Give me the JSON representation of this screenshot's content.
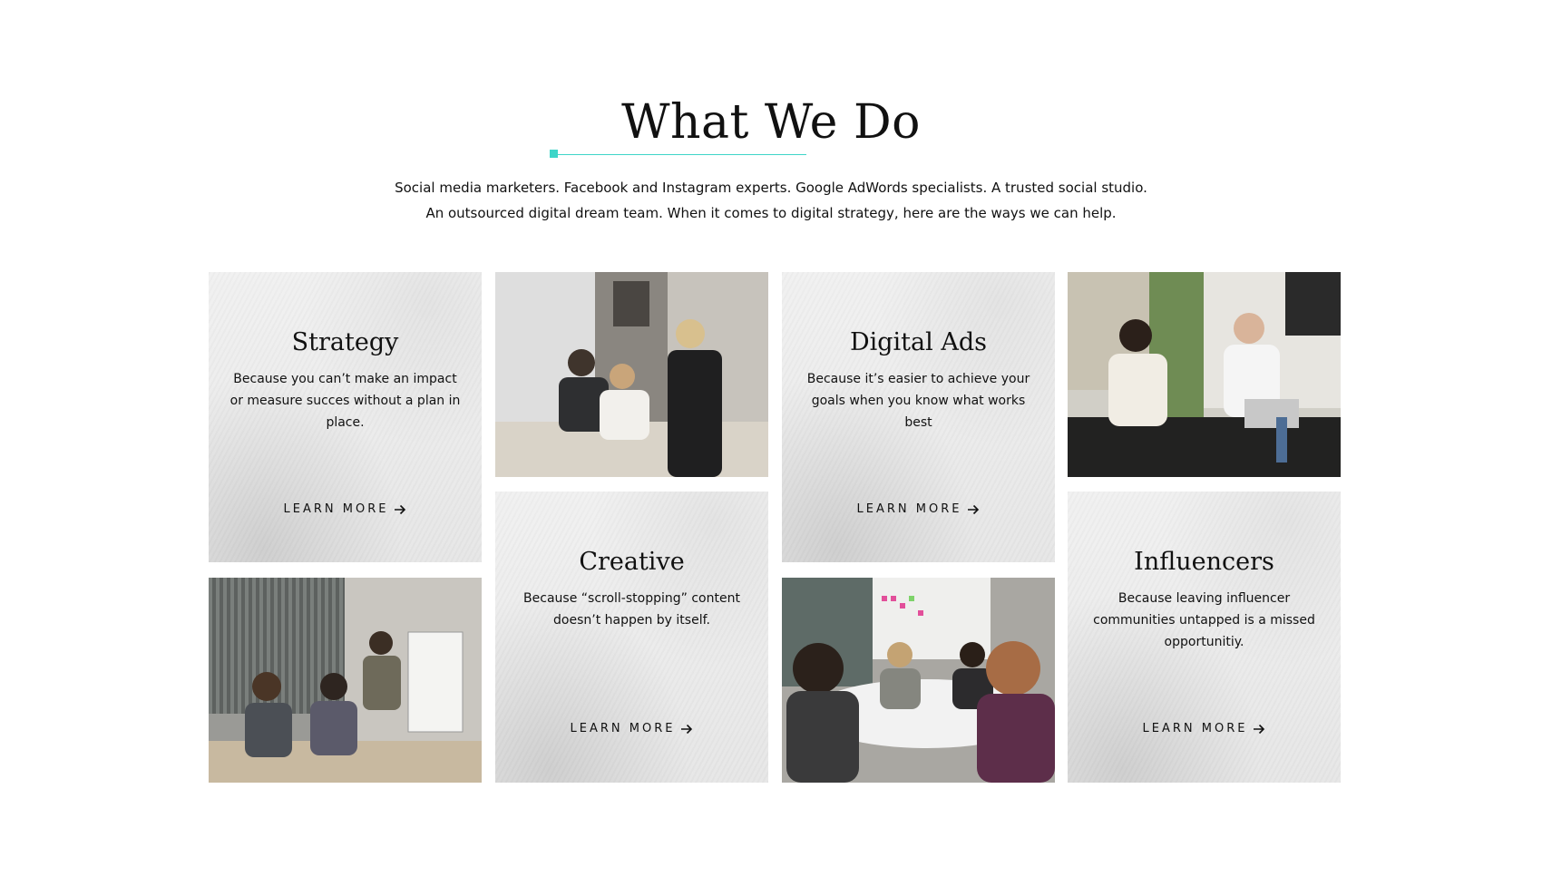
{
  "section": {
    "title": "What We Do",
    "accent_color": "#3ed5c8",
    "intro_line1": "Social media marketers. Facebook and Instagram experts. Google AdWords specialists. A trusted social studio.",
    "intro_line2": "An outsourced digital dream team. When it comes to digital strategy, here are the ways we can help."
  },
  "cards": [
    {
      "title": "Strategy",
      "desc": "Because you can’t make an impact or measure succes without a plan in place.",
      "cta": "LEARN MORE",
      "icon": "arrow-right-icon"
    },
    {
      "title": "Creative",
      "desc": "Because “scroll-stopping” content doesn’t happen by itself.",
      "cta": "LEARN MORE",
      "icon": "arrow-right-icon"
    },
    {
      "title": "Digital Ads",
      "desc": "Because it’s easier to achieve your goals when you know what works best",
      "cta": "LEARN MORE",
      "icon": "arrow-right-icon"
    },
    {
      "title": "Influencers",
      "desc": "Because leaving influencer communities untapped is a missed opportunitiy.",
      "cta": "LEARN MORE",
      "icon": "arrow-right-icon"
    }
  ],
  "photos": [
    "team-meeting-photo",
    "office-laptop-photo",
    "whiteboard-presentation-photo",
    "round-table-meeting-photo"
  ]
}
